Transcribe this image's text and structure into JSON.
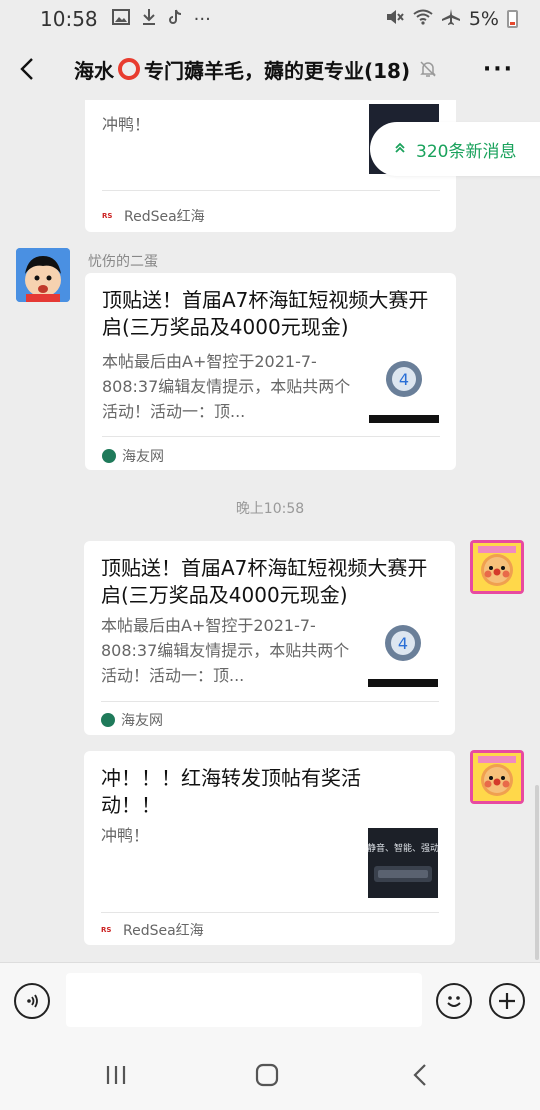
{
  "status_bar": {
    "time": "10:58",
    "icons_left": [
      "image-icon",
      "download-icon",
      "tiktok-icon",
      "more-dots-icon"
    ],
    "icons_right": [
      "mute-icon",
      "wifi-icon",
      "airplane-icon"
    ],
    "battery_text": "5%"
  },
  "header": {
    "title_part1": "海水",
    "title_part2": "专门薅羊毛，薅的更专业(18)",
    "more": "···"
  },
  "new_messages": {
    "label": "320条新消息"
  },
  "messages": [
    {
      "desc": "冲鸭！",
      "source": "RedSea红海"
    },
    {
      "sender": "忧伤的二蛋",
      "title": "顶贴送！首届A7杯海缸短视频大赛开启(三万奖品及4000元现金)",
      "desc": "本帖最后由A+智控于2021-7-808:37编辑友情提示，本贴共两个活动！活动一：顶...",
      "source": "海友网"
    },
    {
      "time_separator": "晚上10:58"
    },
    {
      "title": "顶贴送！首届A7杯海缸短视频大赛开启(三万奖品及4000元现金)",
      "desc": "本帖最后由A+智控于2021-7-808:37编辑友情提示，本贴共两个活动！活动一：顶...",
      "source": "海友网"
    },
    {
      "title": "冲！！！红海转发顶帖有奖活动！！",
      "desc": "冲鸭！",
      "thumb_text": "静音、智能、强动",
      "source": "RedSea红海"
    }
  ],
  "input": {
    "value": "",
    "placeholder": ""
  },
  "colors": {
    "background": "#ededed",
    "accent_green": "#1aa25c",
    "card": "#ffffff"
  }
}
